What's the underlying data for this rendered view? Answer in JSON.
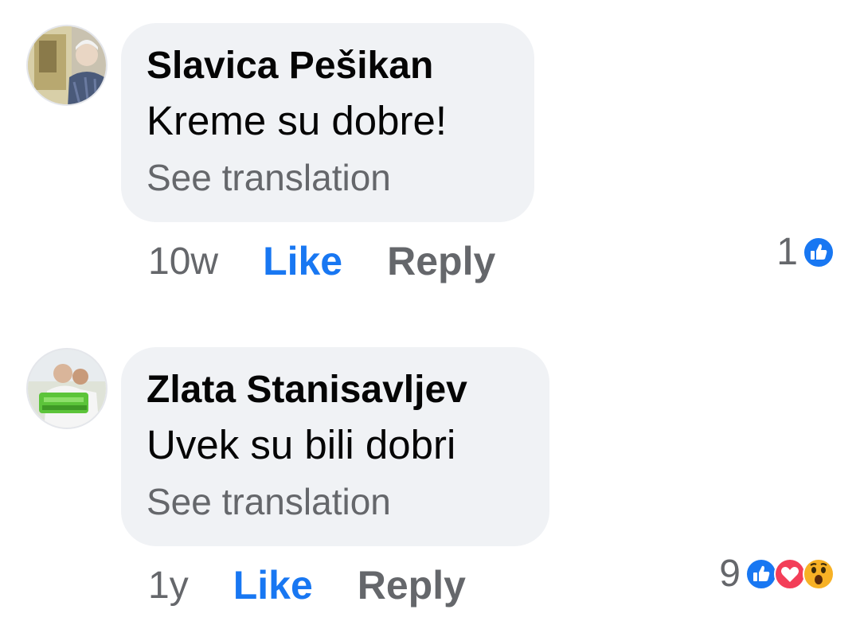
{
  "comments": [
    {
      "author": "Slavica Pešikan",
      "text": "Kreme su dobre!",
      "translate_label": "See translation",
      "time": "10w",
      "like_label": "Like",
      "reply_label": "Reply",
      "reaction_count": "1",
      "reactions": [
        "like-icon"
      ]
    },
    {
      "author": "Zlata Stanisavljev",
      "text": "Uvek su bili dobri",
      "translate_label": "See translation",
      "time": "1y",
      "like_label": "Like",
      "reply_label": "Reply",
      "reaction_count": "9",
      "reactions": [
        "like-icon",
        "love-icon",
        "wow-icon"
      ]
    }
  ],
  "colors": {
    "like_blue": "#1877f2",
    "love_red": "#f33e58",
    "wow_yellow": "#f7b125",
    "bubble_bg": "#f0f2f5",
    "secondary_text": "#65676b"
  }
}
